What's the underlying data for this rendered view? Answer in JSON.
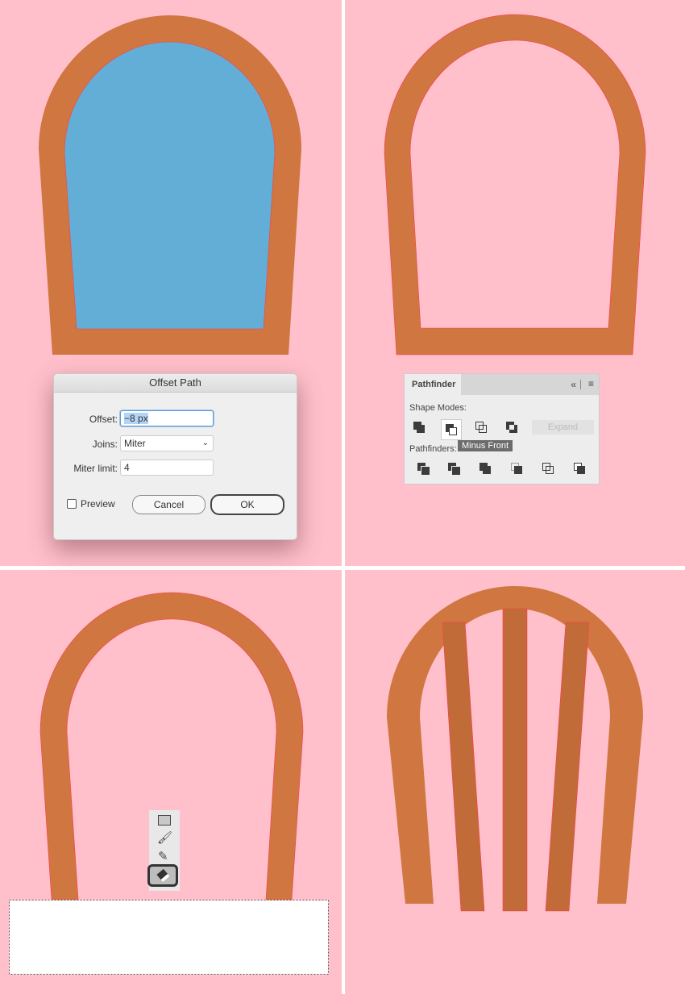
{
  "colors": {
    "background": "#FFC0CB",
    "arch_orange": "#D07640",
    "bar_orange": "#C06B38",
    "inner_blue": "#63AED6",
    "anchor": "#FF3B4E"
  },
  "offset_dialog": {
    "title": "Offset Path",
    "offset_label": "Offset:",
    "offset_value": "−8 px",
    "joins_label": "Joins:",
    "joins_value": "Miter",
    "miter_label": "Miter limit:",
    "miter_value": "4",
    "preview_label": "Preview",
    "preview_checked": false,
    "cancel": "Cancel",
    "ok": "OK"
  },
  "pathfinder": {
    "tab": "Pathfinder",
    "shape_modes_label": "Shape Modes:",
    "expand": "Expand",
    "pathfinders_label": "Pathfinders:",
    "tooltip": "Minus Front",
    "collapse_icon": "double-chevron-left",
    "menu_icon": "hamburger"
  },
  "toolbar": {
    "tools": [
      "rectangle-tool",
      "paintbrush-tool",
      "pencil-tool",
      "eraser-tool"
    ],
    "active": "eraser-tool"
  }
}
